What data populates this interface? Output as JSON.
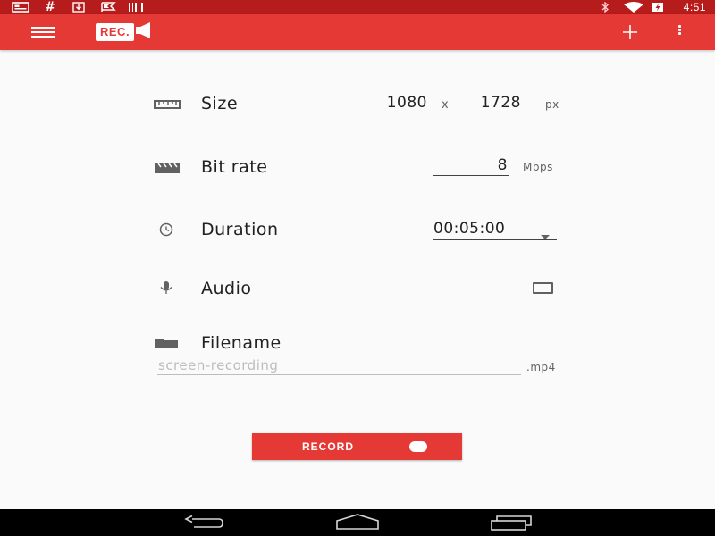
{
  "status_bar": {
    "time": "4:51",
    "icons": [
      "notification-card-icon",
      "hash-icon",
      "download-icon",
      "flag-icon",
      "barcode-icon",
      "bluetooth-icon",
      "wifi-icon",
      "battery-charging-icon"
    ]
  },
  "app_bar": {
    "logo_text": "REC.",
    "icons": [
      "menu-icon",
      "camera-icon",
      "add-icon",
      "overflow-menu-icon"
    ]
  },
  "settings": {
    "size": {
      "label": "Size",
      "width": "1080",
      "times": "x",
      "height": "1728",
      "unit": "px"
    },
    "bitrate": {
      "label": "Bit rate",
      "value": "8",
      "unit": "Mbps"
    },
    "duration": {
      "label": "Duration",
      "value": "00:05:00"
    },
    "audio": {
      "label": "Audio",
      "checked": false
    },
    "filename": {
      "label": "Filename",
      "placeholder": "screen-recording",
      "extension": ".mp4"
    }
  },
  "record_button": {
    "label": "RECORD"
  },
  "nav_bar": {
    "icons": [
      "back-icon",
      "home-icon",
      "recents-icon"
    ]
  },
  "colors": {
    "accent": "#e53935",
    "status_bar": "#b71c1c",
    "background": "#fafafa"
  }
}
